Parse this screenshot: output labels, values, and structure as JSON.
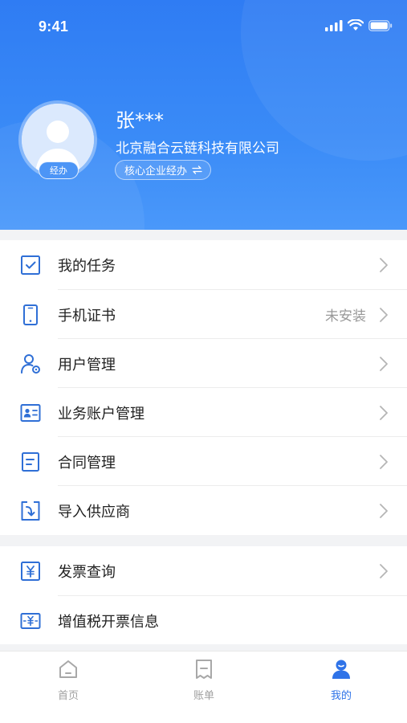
{
  "status_bar": {
    "time": "9:41"
  },
  "profile": {
    "name": "张***",
    "company": "北京融合云链科技有限公司",
    "role": "核心企业经办",
    "avatar_badge": "经办"
  },
  "menu_group_1": [
    {
      "label": "我的任务",
      "icon": "checkbox-icon"
    },
    {
      "label": "手机证书",
      "value": "未安装",
      "icon": "phone-icon"
    },
    {
      "label": "用户管理",
      "icon": "user-settings-icon"
    },
    {
      "label": "业务账户管理",
      "icon": "id-card-icon"
    },
    {
      "label": "合同管理",
      "icon": "contract-icon"
    },
    {
      "label": "导入供应商",
      "icon": "import-icon"
    }
  ],
  "menu_group_2": [
    {
      "label": "发票查询",
      "icon": "yuan-invoice-icon"
    },
    {
      "label": "增值税开票信息",
      "icon": "tax-invoice-icon"
    }
  ],
  "tabbar": [
    {
      "label": "首页",
      "icon": "home-icon",
      "active": false
    },
    {
      "label": "账单",
      "icon": "bill-icon",
      "active": false
    },
    {
      "label": "我的",
      "icon": "profile-icon",
      "active": true
    }
  ],
  "colors": {
    "primary": "#2f73e8",
    "header": "#3a8bf7",
    "icon": "#2f6fd6"
  }
}
